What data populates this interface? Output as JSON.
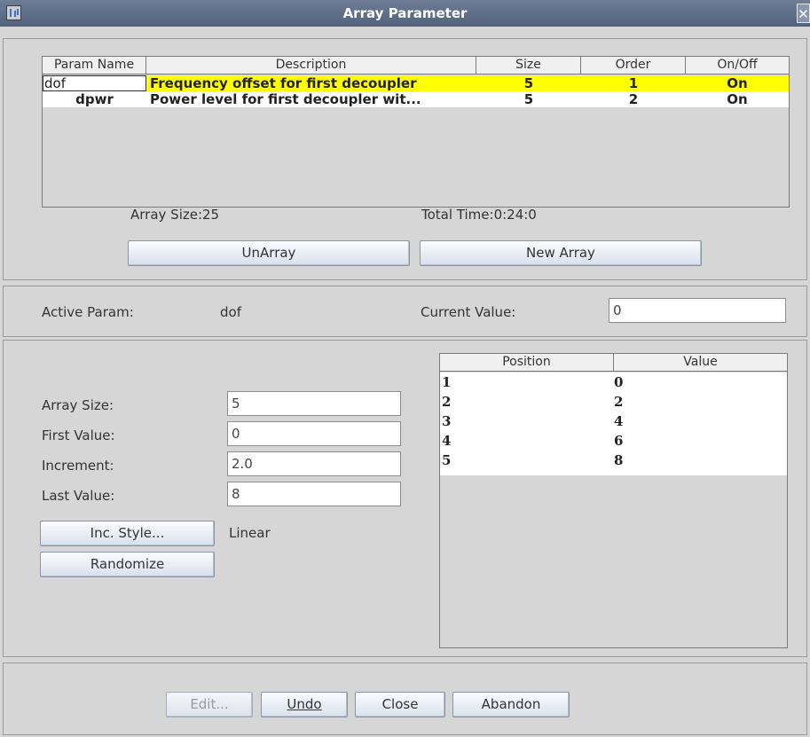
{
  "window": {
    "title": "Array Parameter"
  },
  "param_table": {
    "columns": [
      "Param Name",
      "Description",
      "Size",
      "Order",
      "On/Off"
    ],
    "rows": [
      {
        "name": "dof",
        "description": "Frequency offset for first decoupler",
        "size": "5",
        "order": "1",
        "onoff": "On",
        "selected": true
      },
      {
        "name": "dpwr",
        "description": "Power level for first decoupler wit...",
        "size": "5",
        "order": "2",
        "onoff": "On",
        "selected": false
      }
    ]
  },
  "summary": {
    "array_size": "Array Size:25",
    "total_time": "Total Time:0:24:0"
  },
  "buttons": {
    "unarray": "UnArray",
    "new_array": "New Array",
    "inc_style": "Inc. Style...",
    "randomize": "Randomize",
    "edit": "Edit...",
    "undo": "Undo",
    "close": "Close",
    "abandon": "Abandon"
  },
  "active": {
    "label": "Active Param:",
    "param": "dof",
    "current_label": "Current Value:",
    "current_value": "0"
  },
  "settings": {
    "array_size_label": "Array Size:",
    "array_size": "5",
    "first_label": "First Value:",
    "first": "0",
    "increment_label": "Increment:",
    "increment": "2.0",
    "last_label": "Last Value:",
    "last": "8",
    "style": "Linear"
  },
  "values_table": {
    "columns": [
      "Position",
      "Value"
    ],
    "rows": [
      {
        "position": "1",
        "value": "0"
      },
      {
        "position": "2",
        "value": "2"
      },
      {
        "position": "3",
        "value": "4"
      },
      {
        "position": "4",
        "value": "6"
      },
      {
        "position": "5",
        "value": "8"
      }
    ]
  },
  "colors": {
    "selected_row": "#ffff00",
    "titlebar": "#5f6f88"
  }
}
